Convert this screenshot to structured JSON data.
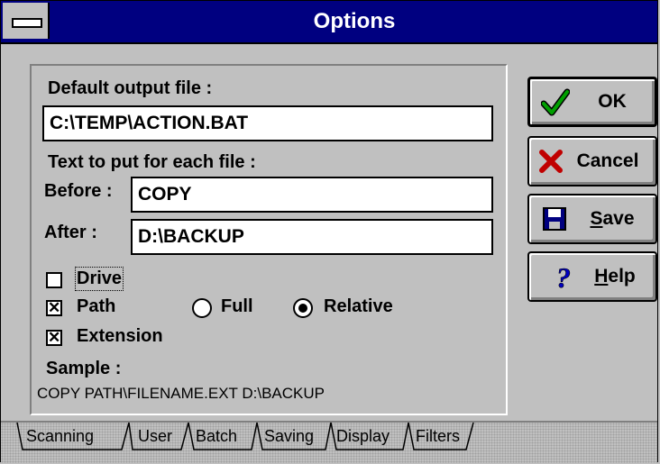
{
  "window": {
    "title": "Options"
  },
  "form": {
    "default_output_label": "Default output file :",
    "default_output_value": "C:\\TEMP\\ACTION.BAT",
    "text_each_file_label": "Text to put for each file :",
    "before_label": "Before :",
    "before_value": "COPY",
    "after_label": "After :",
    "after_value": "D:\\BACKUP",
    "drive_label": "Drive",
    "drive_checked": false,
    "path_label": "Path",
    "path_checked": true,
    "full_label": "Full",
    "relative_label": "Relative",
    "path_mode_selected": "Relative",
    "extension_label": "Extension",
    "extension_checked": true,
    "sample_label": "Sample :",
    "sample_value": "COPY  PATH\\FILENAME.EXT D:\\BACKUP"
  },
  "buttons": {
    "ok": "OK",
    "cancel": "Cancel",
    "save_mn": "S",
    "save_rest": "ave",
    "help_mn": "H",
    "help_rest": "elp"
  },
  "icons": {
    "ok": "checkmark-icon",
    "cancel": "x-icon",
    "save": "floppy-disk-icon",
    "help": "question-mark-icon"
  },
  "tabs": [
    "Scanning",
    "User",
    "Batch",
    "Saving",
    "Display",
    "Filters"
  ],
  "active_tab": "Batch",
  "colors": {
    "title_bar": "#000080",
    "face": "#c0c0c0",
    "check_green": "#008000",
    "x_red": "#c00000",
    "help_blue": "#0000c0"
  }
}
